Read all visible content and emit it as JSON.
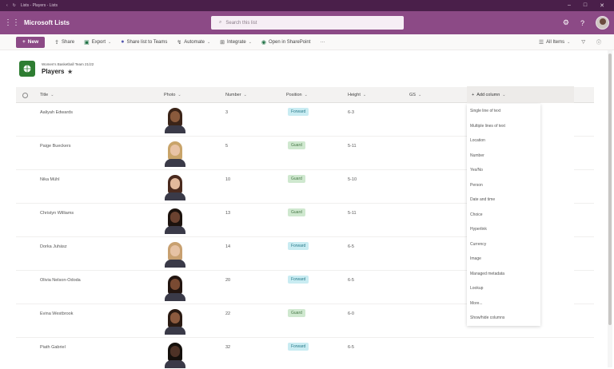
{
  "window": {
    "title": "Lists - Players - Lists",
    "controls": [
      "–",
      "□",
      "✕"
    ]
  },
  "suite": {
    "app_name": "Microsoft Lists",
    "search_placeholder": "Search this list",
    "brand_color": "#8c4a86"
  },
  "commands": {
    "new": "New",
    "share": "Share",
    "export": "Export",
    "share_teams": "Share list to Teams",
    "automate": "Automate",
    "integrate": "Integrate",
    "open_sharepoint": "Open in SharePoint",
    "more": "···",
    "view": "All Items"
  },
  "list": {
    "subtitle": "Women's Basketball Team 21/22",
    "title": "Players"
  },
  "columns": {
    "title": "Title",
    "photo": "Photo",
    "number": "Number",
    "position": "Position",
    "height": "Height",
    "gs": "GS",
    "add_column": "Add column"
  },
  "rows": [
    {
      "title": "Aaliyah Edwards",
      "number": "3",
      "position": "Forward",
      "height": "6-3",
      "hair": "#3b2418",
      "skin": "#8a5a3c"
    },
    {
      "title": "Paige Bueckers",
      "number": "5",
      "position": "Guard",
      "height": "5-11",
      "hair": "#c9a46a",
      "skin": "#e8c3a6"
    },
    {
      "title": "Nika Mühl",
      "number": "10",
      "position": "Guard",
      "height": "5-10",
      "hair": "#4a2a1e",
      "skin": "#e2b99c"
    },
    {
      "title": "Christyn Williams",
      "number": "13",
      "position": "Guard",
      "height": "5-11",
      "hair": "#1c120d",
      "skin": "#6b4230"
    },
    {
      "title": "Dorka Juhász",
      "number": "14",
      "position": "Forward",
      "height": "6-5",
      "hair": "#c8a070",
      "skin": "#e6c2a4"
    },
    {
      "title": "Olivia Nelson-Ododa",
      "number": "20",
      "position": "Forward",
      "height": "6-5",
      "hair": "#221510",
      "skin": "#7a4a32"
    },
    {
      "title": "Evina Westbrook",
      "number": "22",
      "position": "Guard",
      "height": "6-0",
      "hair": "#2a1a12",
      "skin": "#8c5a3e"
    },
    {
      "title": "Piath Gabriel",
      "number": "32",
      "position": "Forward",
      "height": "6-5",
      "hair": "#15100c",
      "skin": "#4e3226"
    }
  ],
  "add_column_menu": [
    "Single line of text",
    "Multiple lines of text",
    "Location",
    "Number",
    "Yes/No",
    "Person",
    "Date and time",
    "Choice",
    "Hyperlink",
    "Currency",
    "Image",
    "Managed metadata",
    "Lookup",
    "More...",
    "Show/hide columns"
  ]
}
